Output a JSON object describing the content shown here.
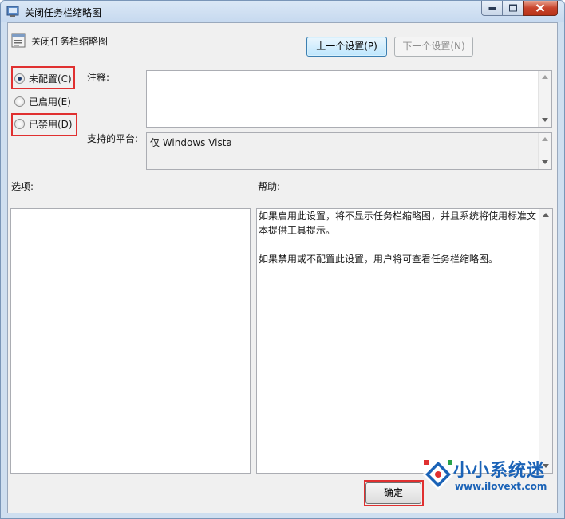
{
  "window": {
    "title": "关闭任务栏缩略图",
    "controls": {
      "minimize": "minimize-icon",
      "maximize": "maximize-icon",
      "close": "close-icon"
    }
  },
  "setting": {
    "name": "关闭任务栏缩略图"
  },
  "nav": {
    "prev_label": "上一个设置(P)",
    "next_label": "下一个设置(N)"
  },
  "radios": [
    {
      "label": "未配置(C)",
      "checked": true
    },
    {
      "label": "已启用(E)",
      "checked": false
    },
    {
      "label": "已禁用(D)",
      "checked": false
    }
  ],
  "comment": {
    "label": "注释:",
    "value": ""
  },
  "platform": {
    "label": "支持的平台:",
    "value": "仅 Windows Vista"
  },
  "options": {
    "label": "选项:"
  },
  "help": {
    "label": "帮助:",
    "paragraphs": [
      "如果启用此设置，将不显示任务栏缩略图，并且系统将使用标准文本提供工具提示。",
      "如果禁用或不配置此设置，用户将可查看任务栏缩略图。"
    ]
  },
  "footer": {
    "ok_label": "确定"
  },
  "watermark": {
    "brand": "小小系统迷",
    "url": "www.ilovext.com"
  },
  "colors": {
    "highlight": "#e03030",
    "titlebar": "#c6d9ef",
    "brand_blue": "#1b63b7"
  }
}
